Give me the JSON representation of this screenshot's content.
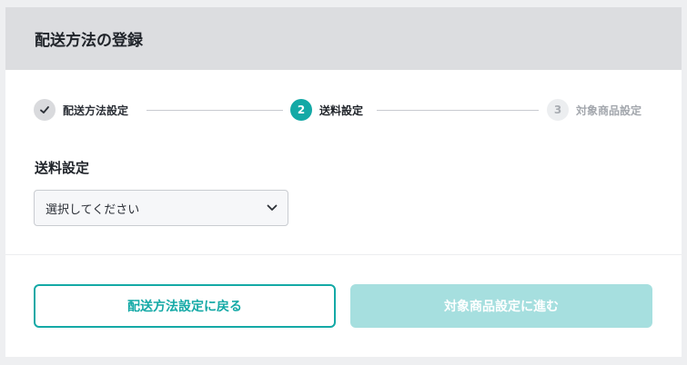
{
  "header": {
    "title": "配送方法の登録"
  },
  "stepper": {
    "steps": [
      {
        "number": "✓",
        "label": "配送方法設定",
        "status": "completed"
      },
      {
        "number": "2",
        "label": "送料設定",
        "status": "active"
      },
      {
        "number": "3",
        "label": "対象商品設定",
        "status": "upcoming"
      }
    ]
  },
  "form": {
    "label": "送料設定",
    "select": {
      "value": "選択してください"
    }
  },
  "actions": {
    "back_label": "配送方法設定に戻る",
    "next_label": "対象商品設定に進む"
  },
  "colors": {
    "accent": "#14a9a6",
    "accent_disabled": "#a6dfdf",
    "header_bg": "#dcdde0"
  }
}
